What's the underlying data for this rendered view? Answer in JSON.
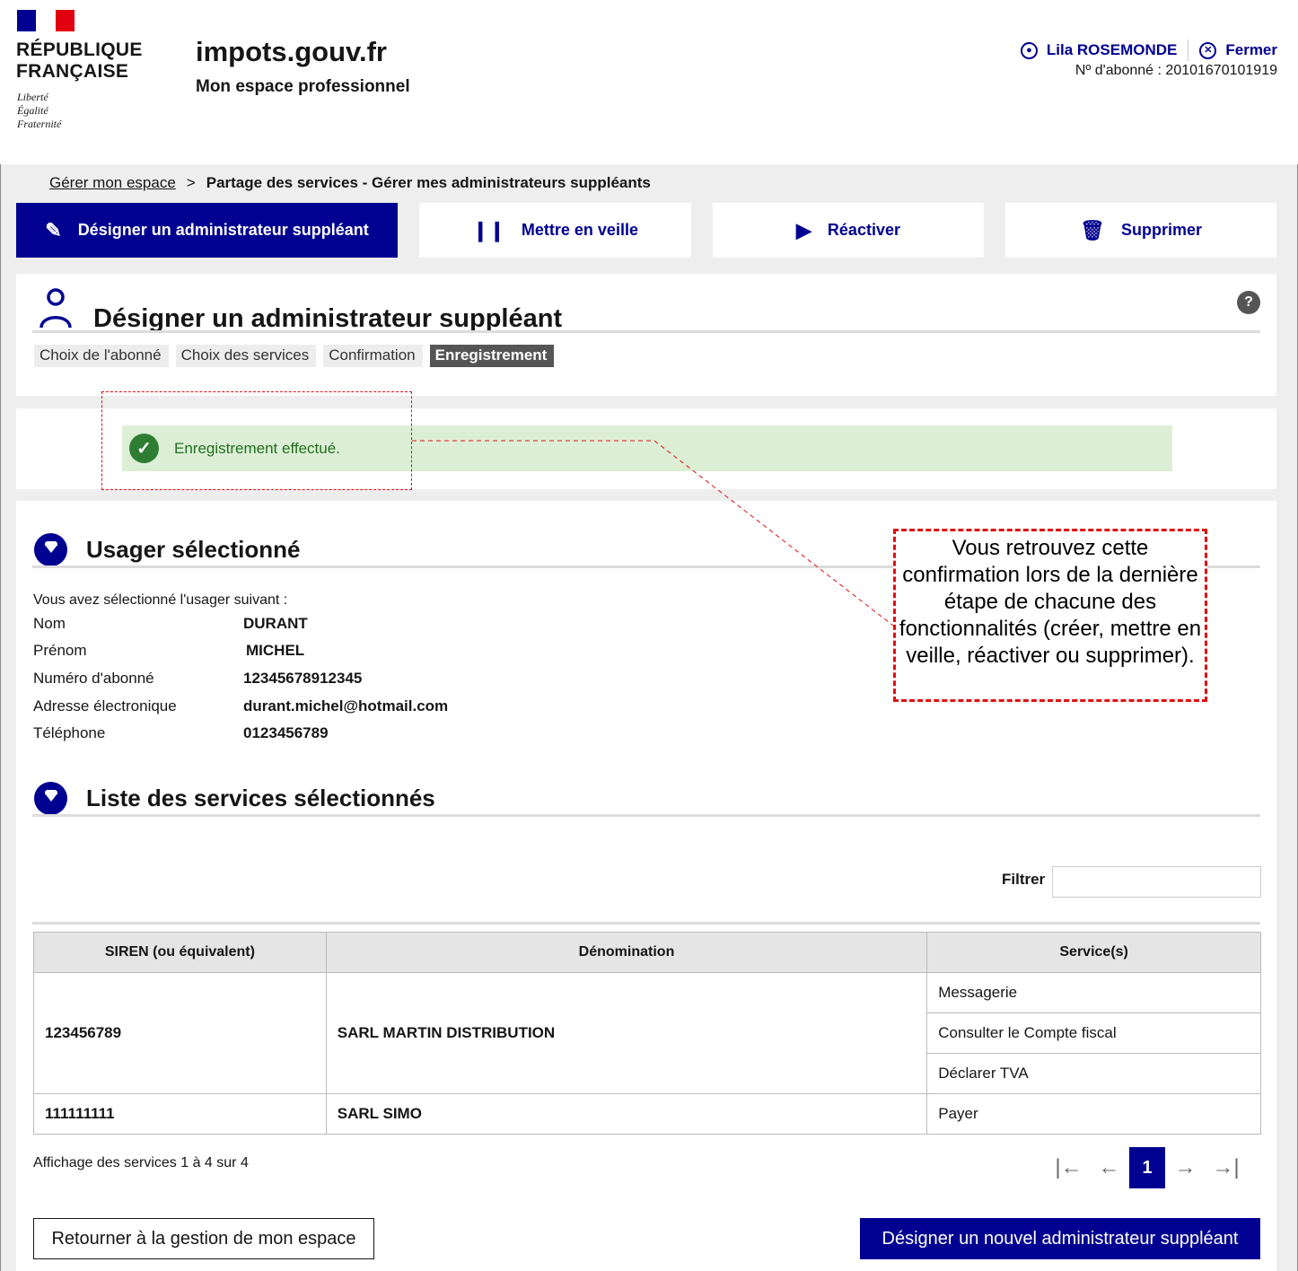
{
  "header": {
    "republique": "RÉPUBLIQUE",
    "francaise": "FRANÇAISE",
    "devise": [
      "Liberté",
      "Égalité",
      "Fraternité"
    ],
    "site_title": "impots.gouv.fr",
    "site_subtitle": "Mon espace professionnel",
    "user_name": "Lila ROSEMONDE",
    "close_label": "Fermer",
    "subscriber_no": "Nº d'abonné : 20101670101919"
  },
  "breadcrumb": {
    "link": "Gérer mon espace",
    "separator": ">",
    "current": "Partage des services - Gérer mes administrateurs suppléants"
  },
  "actions": {
    "designate": "Désigner un administrateur suppléant",
    "standby": "Mettre en veille",
    "reactivate": "Réactiver",
    "delete": "Supprimer"
  },
  "page": {
    "title": "Désigner un administrateur suppléant",
    "help": "?",
    "steps": [
      "Choix de l'abonné",
      "Choix des services",
      "Confirmation",
      "Enregistrement"
    ],
    "current_step": 3
  },
  "alert": {
    "message": "Enregistrement effectué."
  },
  "user_section": {
    "title": "Usager sélectionné",
    "intro": "Vous avez sélectionné l'usager suivant :",
    "fields": [
      {
        "label": "Nom",
        "value": "DURANT"
      },
      {
        "label": "Prénom",
        "value": "MICHEL"
      },
      {
        "label": "Numéro d'abonné",
        "value": "12345678912345"
      },
      {
        "label": "Adresse électronique",
        "value": "durant.michel@hotmail.com"
      },
      {
        "label": "Téléphone",
        "value": "0123456789"
      }
    ]
  },
  "services_section": {
    "title": "Liste des services sélectionnés",
    "filter_label": "Filtrer",
    "filter_value": "",
    "columns": [
      "SIREN (ou équivalent)",
      "Dénomination",
      "Service(s)"
    ],
    "rows": [
      {
        "siren": "123456789",
        "name": "SARL MARTIN DISTRIBUTION",
        "services": [
          "Messagerie",
          "Consulter le Compte fiscal",
          "Déclarer TVA"
        ]
      },
      {
        "siren": "111111111",
        "name": "SARL SIMO",
        "services": [
          "Payer"
        ]
      }
    ],
    "paging_info": "Affichage des services 1 à 4 sur 4",
    "pager": {
      "first": "|←",
      "prev": "←",
      "current": "1",
      "next": "→",
      "last": "→|"
    }
  },
  "buttons": {
    "back": "Retourner à la gestion de mon espace",
    "new": "Désigner un nouvel administrateur suppléant"
  },
  "annotation": {
    "text": "Vous retrouvez cette confirmation lors de la dernière étape de chacune des fonctionnalités (créer, mettre en veille, réactiver ou supprimer).",
    "color": "#e01010"
  },
  "colors": {
    "primary": "#000091",
    "success_bg": "#dcefd5",
    "success": "#2e7d32",
    "background": "#eeeeee"
  }
}
